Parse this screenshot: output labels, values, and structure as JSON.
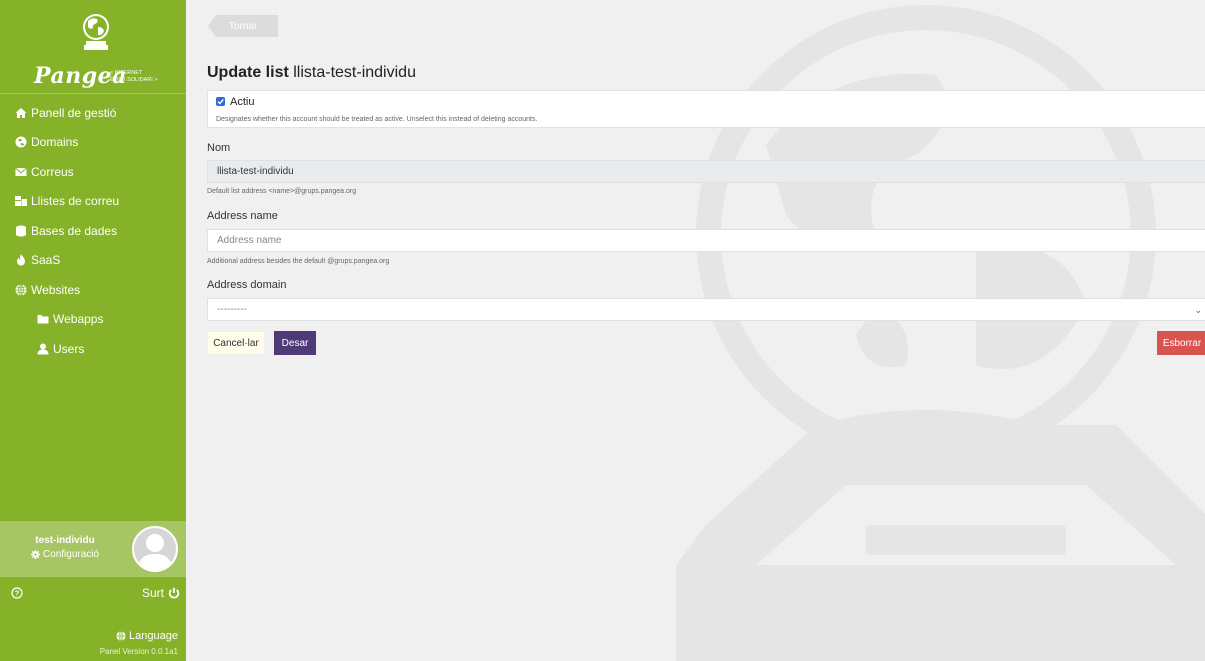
{
  "sidebar": {
    "logo_text": "Pangea",
    "logo_tag": [
      "< INTERNET",
      "ÈTIC I SOLIDARI >"
    ],
    "items": [
      {
        "label": "Panell de gestió",
        "icon": "home-icon"
      },
      {
        "label": "Domains",
        "icon": "globe-circle-icon"
      },
      {
        "label": "Correus",
        "icon": "envelope-icon"
      },
      {
        "label": "Llistes de correu",
        "icon": "mail-bulk-icon"
      },
      {
        "label": "Bases de dades",
        "icon": "database-icon"
      },
      {
        "label": "SaaS",
        "icon": "fire-icon"
      },
      {
        "label": "Websites",
        "icon": "globe-icon"
      },
      {
        "label": "Webapps",
        "icon": "folder-icon"
      },
      {
        "label": "Users",
        "icon": "user-icon"
      }
    ],
    "user": {
      "name": "test-individu",
      "config_label": "Configuració"
    },
    "logout_label": "Surt",
    "language_label": "Language",
    "version": "Panel Version 0.0.1a1"
  },
  "main": {
    "back_label": "Tornar",
    "title_prefix": "Update list",
    "title_name": "llista-test-individu",
    "active": {
      "label": "Actiu",
      "checked": true,
      "help": "Designates whether this account should be treated as active. Unselect this instead of deleting accounts."
    },
    "nom": {
      "label": "Nom",
      "value": "llista-test-individu",
      "help": "Default list address <name>@grups.pangea.org"
    },
    "address_name": {
      "label": "Address name",
      "placeholder": "Address name",
      "help": "Additional address besides the default @grups.pangea.org"
    },
    "address_domain": {
      "label": "Address domain",
      "value": "---------"
    },
    "buttons": {
      "cancel": "Cancel·lar",
      "save": "Desar",
      "delete": "Esborrar"
    }
  },
  "colors": {
    "sidebar": "#86b22a",
    "save": "#4f3a78",
    "delete": "#d9534f"
  }
}
